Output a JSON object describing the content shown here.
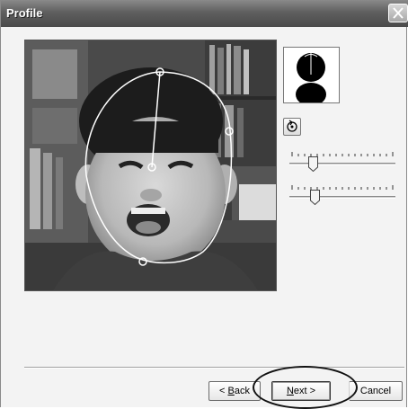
{
  "window": {
    "title": "Profile"
  },
  "icons": {
    "close": "close-icon",
    "rotate": "rotate-icon",
    "preview": "head-silhouette-icon"
  },
  "sliders": [
    {
      "name": "width-slider",
      "value_fraction": 0.22
    },
    {
      "name": "height-slider",
      "value_fraction": 0.24
    }
  ],
  "buttons": {
    "back_prefix": "< ",
    "back_key": "B",
    "back_rest": "ack",
    "next_key": "N",
    "next_rest": "ext >",
    "cancel_label": "Cancel"
  },
  "colors": {
    "titlebar": "#5f5f5f",
    "dialog_bg": "#f3f3f3",
    "outline": "#ffffff"
  }
}
